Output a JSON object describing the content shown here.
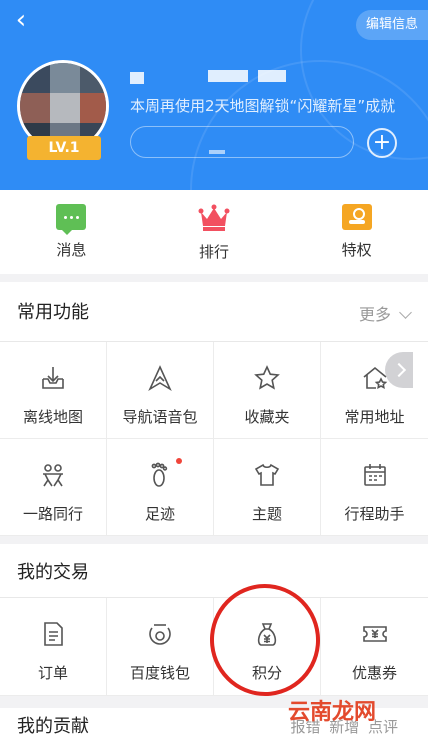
{
  "header": {
    "edit_label": "编辑信息",
    "level": "LV.1",
    "achievement_text": "本周再使用2天地图解锁“闪耀新星”成就",
    "add_icon": "plus-icon",
    "back_icon": "chevron-left-icon"
  },
  "quick_actions": [
    {
      "label": "消息",
      "icon": "message-icon",
      "color": "#5fbf55"
    },
    {
      "label": "排行",
      "icon": "crown-icon",
      "color": "#f25060"
    },
    {
      "label": "特权",
      "icon": "privilege-card-icon",
      "color": "#f5a623"
    }
  ],
  "common": {
    "title": "常用功能",
    "more_label": "更多",
    "items": [
      {
        "label": "离线地图",
        "icon": "download-tray-icon"
      },
      {
        "label": "导航语音包",
        "icon": "navigation-arrow-icon"
      },
      {
        "label": "收藏夹",
        "icon": "star-icon"
      },
      {
        "label": "常用地址",
        "icon": "home-star-icon"
      },
      {
        "label": "一路同行",
        "icon": "people-icon"
      },
      {
        "label": "足迹",
        "icon": "footprint-icon"
      },
      {
        "label": "主题",
        "icon": "tshirt-icon"
      },
      {
        "label": "行程助手",
        "icon": "calendar-icon"
      }
    ]
  },
  "trade": {
    "title": "我的交易",
    "items": [
      {
        "label": "订单",
        "icon": "document-icon"
      },
      {
        "label": "百度钱包",
        "icon": "wallet-icon"
      },
      {
        "label": "积分",
        "icon": "money-bag-icon"
      },
      {
        "label": "优惠券",
        "icon": "coupon-icon"
      }
    ]
  },
  "contrib": {
    "title": "我的贡献",
    "tags": "报错 新增 点评"
  },
  "watermark": "云南龙网",
  "colors": {
    "header_bg": "#2f8cf5",
    "level_badge": "#f4b330",
    "annotation_circle": "#e0261f"
  }
}
